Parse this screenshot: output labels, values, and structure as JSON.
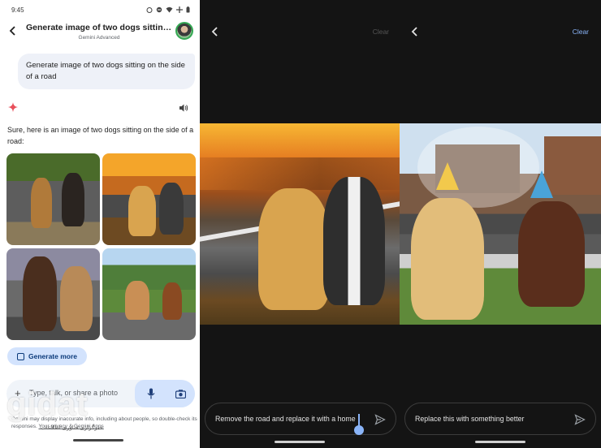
{
  "status_bar": {
    "time": "9:45"
  },
  "chat": {
    "title": "Generate image of two dogs sitting on the side of a road",
    "subtitle": "Gemini Advanced",
    "user_message": "Generate image of two dogs sitting on the side of a road",
    "response_text": "Sure, here is an image of two dogs sitting on the side of a road:",
    "generate_more_label": "Generate more",
    "input_placeholder": "Type, talk, or share a photo",
    "disclaimer_start": "Gemini may display inaccurate info, including about people, so double-check its responses. ",
    "disclaimer_link": "Your privacy & Gemini Apps"
  },
  "watermark": {
    "text": "gidat",
    "sub": "خبرگزاری فناوری اطلاعات"
  },
  "editor_left": {
    "clear_label": "Clear",
    "prompt": "Remove the road and replace it with a home"
  },
  "editor_right": {
    "clear_label": "Clear",
    "prompt": "Replace this with something better"
  },
  "icons": {
    "back": "arrow-back-icon",
    "sparkle": "gemini-sparkle-icon",
    "speaker": "speaker-icon",
    "mic": "mic-icon",
    "camera": "camera-icon",
    "send": "send-icon",
    "plus": "plus-icon"
  },
  "colors": {
    "accent": "#8ab4f8",
    "chip_bg": "#d3e3fd",
    "sparkle": "#e8505b"
  }
}
